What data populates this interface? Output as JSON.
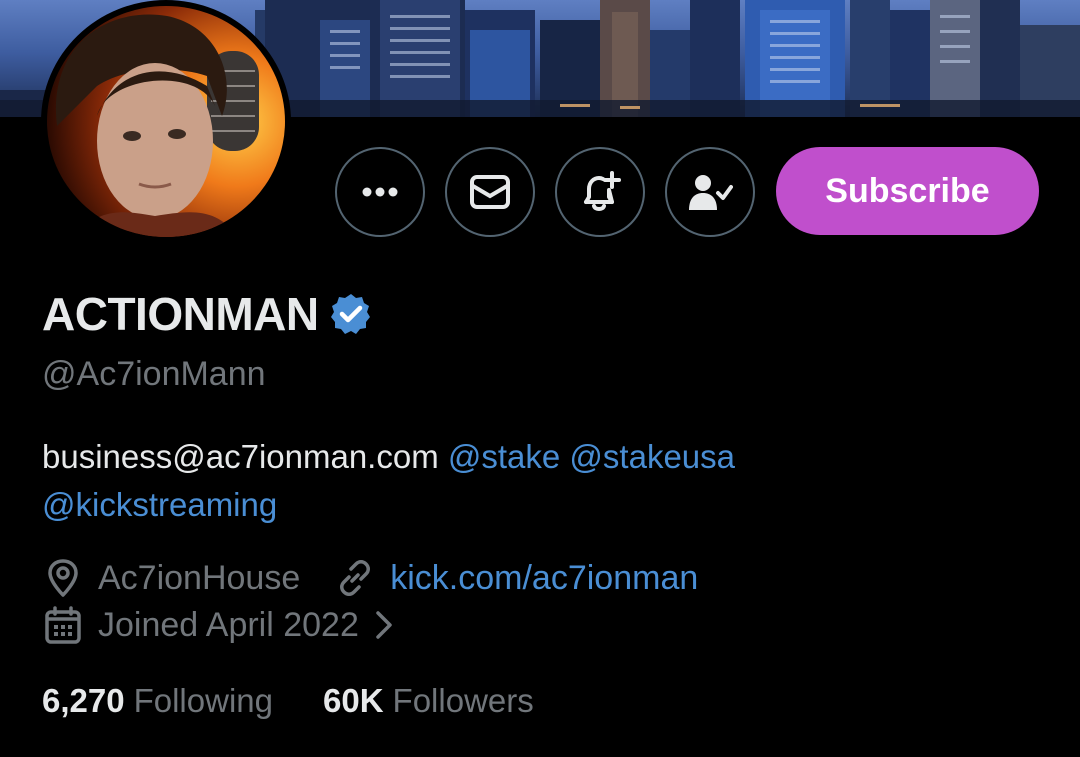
{
  "profile": {
    "display_name": "ACTIONMAN",
    "handle": "@Ac7ionMann",
    "verified": true,
    "bio": {
      "text": "business@ac7ionman.com",
      "mentions": [
        "@stake",
        "@stakeusa",
        "@kickstreaming"
      ]
    },
    "location": "Ac7ionHouse",
    "website": "kick.com/ac7ionman",
    "joined": "Joined April 2022"
  },
  "actions": {
    "subscribe_label": "Subscribe",
    "more_icon": "more-horizontal-icon",
    "message_icon": "envelope-icon",
    "notify_icon": "bell-plus-icon",
    "following_icon": "person-check-icon"
  },
  "stats": {
    "following_count": "6,270",
    "following_label": "Following",
    "followers_count": "60K",
    "followers_label": "Followers"
  },
  "colors": {
    "background": "#000000",
    "subscribe": "#c04fcc",
    "link": "#4a8ed4",
    "verified": "#4a8ed4",
    "muted": "#71767b"
  }
}
